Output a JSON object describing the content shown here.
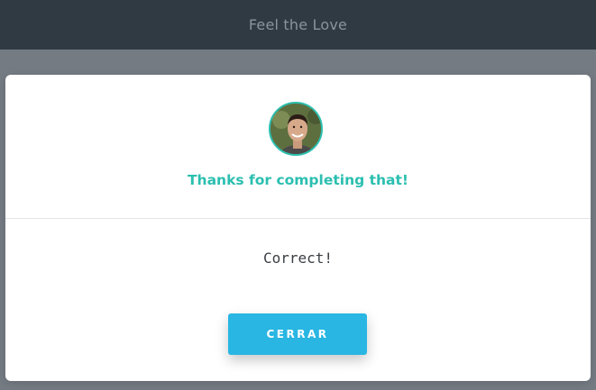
{
  "header": {
    "title": "Feel the Love"
  },
  "modal": {
    "headline": "Thanks for completing that!",
    "message": "Correct!",
    "close_label": "CERRAR"
  },
  "colors": {
    "accent_teal": "#2bbfb0",
    "button_blue": "#29b6e3",
    "topbar": "#2f3a42"
  }
}
